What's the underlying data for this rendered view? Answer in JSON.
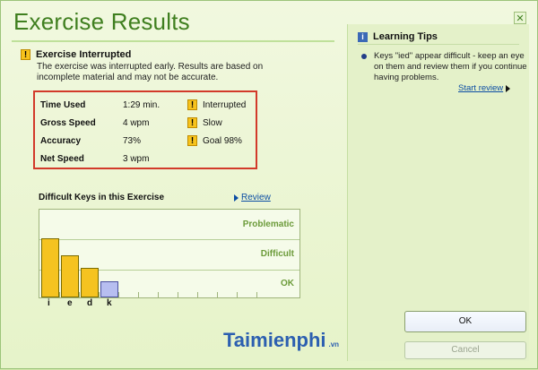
{
  "window": {
    "title": "Exercise Results",
    "close_symbol": "✕"
  },
  "interrupted": {
    "heading": "Exercise Interrupted",
    "description": "The exercise was interrupted early. Results are based on incomplete material and may not be accurate."
  },
  "stats": [
    {
      "label": "Time Used",
      "value": "1:29 min.",
      "note": "Interrupted",
      "note_icon": "warning-icon"
    },
    {
      "label": "Gross Speed",
      "value": "4 wpm",
      "note": "Slow",
      "note_icon": "warning-icon"
    },
    {
      "label": "Accuracy",
      "value": "73%",
      "note": "Goal 98%",
      "note_icon": "warning-icon"
    },
    {
      "label": "Net Speed",
      "value": "3 wpm",
      "note": "",
      "note_icon": ""
    }
  ],
  "difficult_keys": {
    "title": "Difficult Keys in this Exercise",
    "review_label": "Review"
  },
  "chart_data": {
    "type": "bar",
    "title": "",
    "xlabel": "",
    "ylabel": "",
    "categories": [
      "i",
      "e",
      "d",
      "k"
    ],
    "values": [
      2.7,
      1.9,
      1.35,
      0.75
    ],
    "band_labels": [
      "Problematic",
      "Difficult",
      "OK"
    ],
    "ylim": [
      0,
      4
    ],
    "colors": [
      "#f5c320",
      "#f5c320",
      "#f5c320",
      "#b7bef0"
    ]
  },
  "learning_tips": {
    "heading": "Learning Tips",
    "tip": "Keys \"ied\" appear difficult - keep an eye on them and review them if you continue having problems.",
    "start_review_label": "Start review"
  },
  "buttons": {
    "ok": "OK",
    "cancel": "Cancel"
  },
  "watermark": {
    "text": "Taimienphi",
    "suffix": ".vn"
  }
}
